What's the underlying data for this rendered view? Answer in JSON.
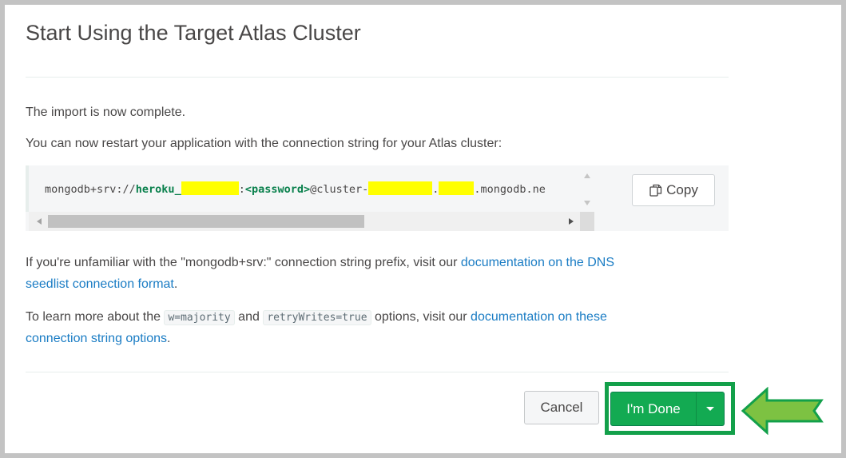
{
  "dialog": {
    "title": "Start Using the Target Atlas Cluster",
    "import_complete": "The import is now complete.",
    "restart_text": "You can now restart your application with the connection string for your Atlas cluster:",
    "connection_string": {
      "prefix": "mongodb+srv://",
      "user": "heroku_",
      "separator": ":",
      "password": "<password>",
      "host_prefix": "@cluster-",
      "dot": ".",
      "domain": ".mongodb.ne"
    },
    "copy_label": "Copy",
    "dns_text": "If you're unfamiliar with the \"mongodb+srv:\" connection string prefix, visit our ",
    "dns_link_1": "documentation on the DNS",
    "dns_link_2": "seedlist connection format",
    "dns_end": ".",
    "options_text_1": "To learn more about the ",
    "option_w": "w=majority",
    "options_and": " and ",
    "option_retry": "retryWrites=true",
    "options_text_2": " options, visit our ",
    "options_link_1": "documentation on these",
    "options_link_2": "connection string options",
    "options_end": ".",
    "cancel_label": "Cancel",
    "done_label": "I'm Done"
  },
  "colors": {
    "accent_green": "#13aa52",
    "highlight_green": "#13a04a",
    "arrow_green": "#7dc242",
    "link_blue": "#1a7cc4",
    "redaction_yellow": "#ffff00"
  },
  "icons": {
    "copy": "copy-icon",
    "caret": "caret-down-icon",
    "pointer": "pointer-arrow-icon"
  }
}
